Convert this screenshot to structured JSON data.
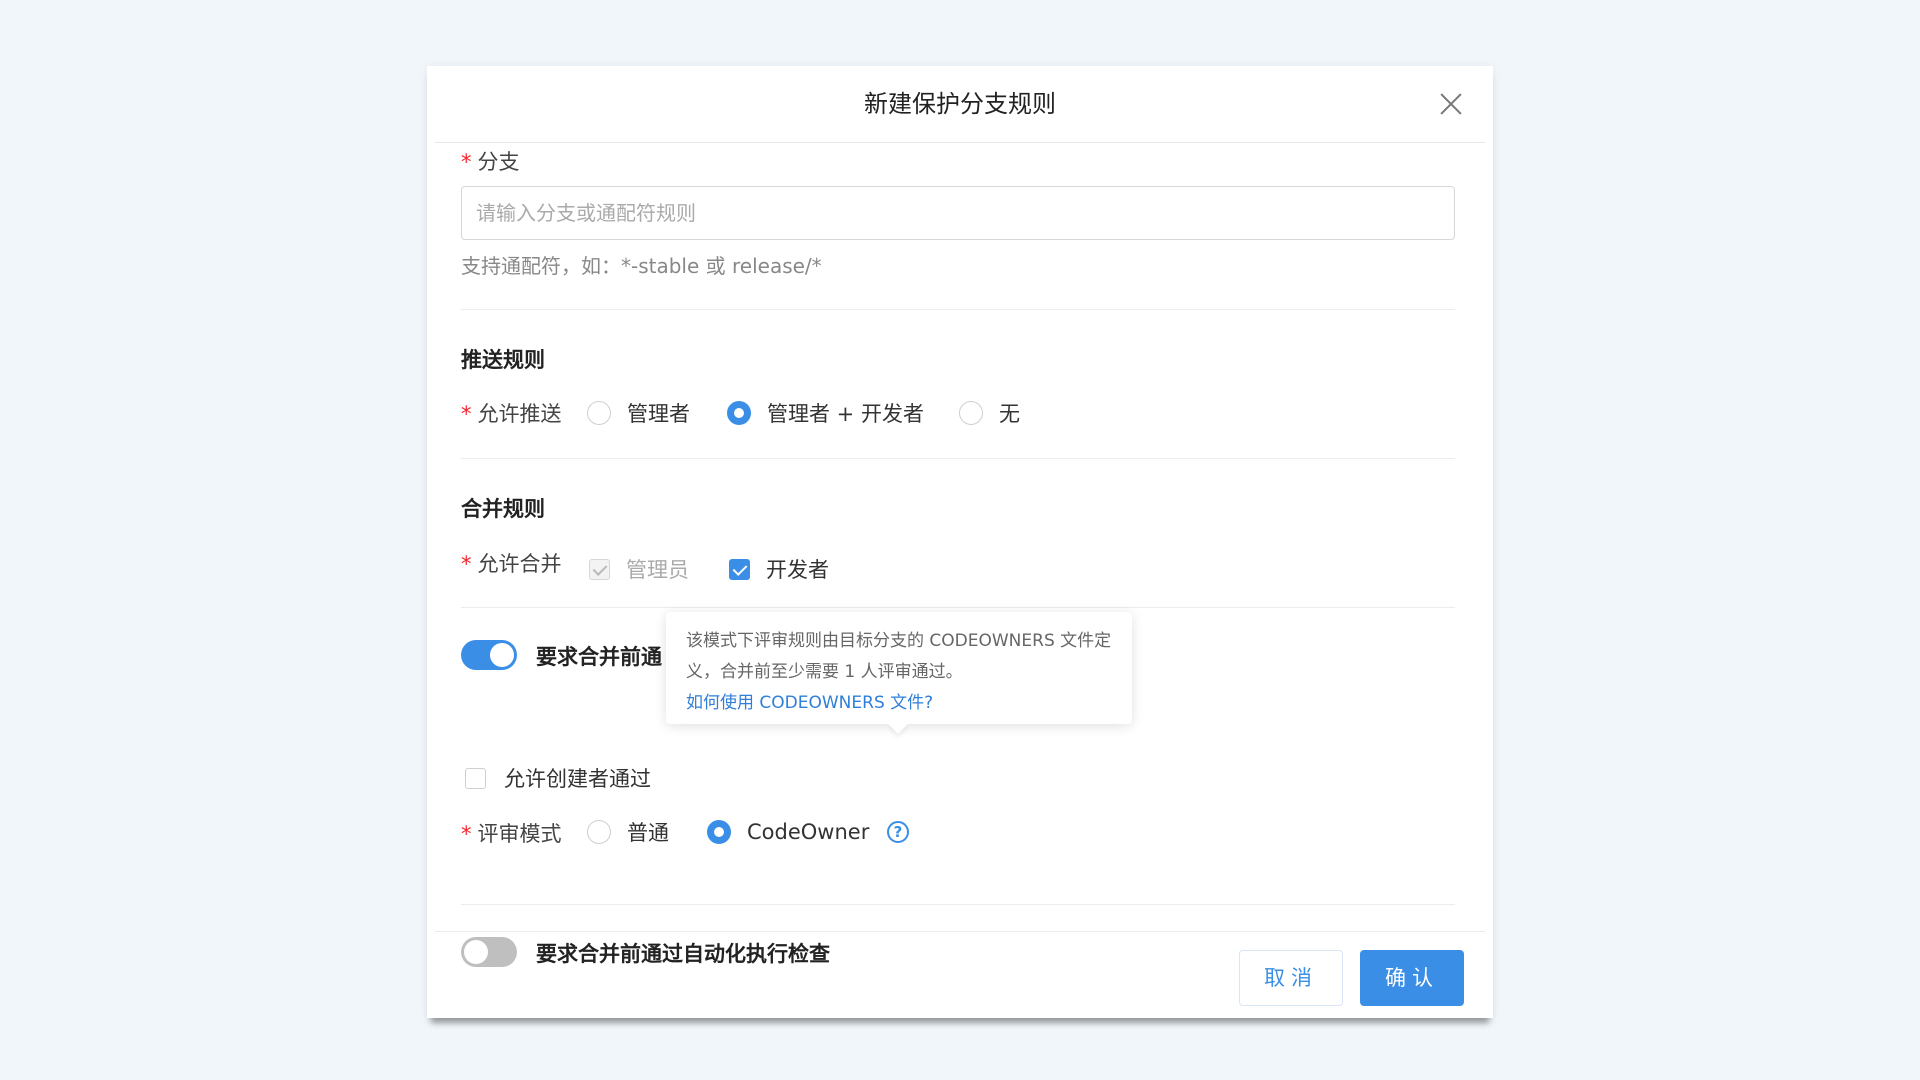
{
  "dialog": {
    "title": "新建保护分支规则",
    "close_icon": "close-icon"
  },
  "branch": {
    "required_mark": "*",
    "label": "分支",
    "placeholder": "请输入分支或通配符规则",
    "value": "",
    "hint": "支持通配符，如：*-stable 或 release/*"
  },
  "push_rules": {
    "section_title": "推送规则",
    "required_mark": "*",
    "label": "允许推送",
    "options": [
      {
        "label": "管理者",
        "checked": false
      },
      {
        "label": "管理者 + 开发者",
        "checked": true
      },
      {
        "label": "无",
        "checked": false
      }
    ]
  },
  "merge_rules": {
    "section_title": "合并规则",
    "required_mark": "*",
    "label": "允许合并",
    "options": [
      {
        "label": "管理员",
        "checked": true,
        "disabled": true
      },
      {
        "label": "开发者",
        "checked": true,
        "disabled": false
      }
    ]
  },
  "review": {
    "toggle_on": true,
    "toggle_label": "要求合并前通",
    "allow_creator_label": "允许创建者通过",
    "allow_creator_checked": false,
    "required_mark": "*",
    "mode_label": "评审模式",
    "mode_options": [
      {
        "label": "普通",
        "checked": false
      },
      {
        "label": "CodeOwner",
        "checked": true
      }
    ],
    "help_icon_text": "?"
  },
  "tooltip": {
    "text": "该模式下评审规则由目标分支的 CODEOWNERS 文件定义，合并前至少需要 1 人评审通过。",
    "link": "如何使用 CODEOWNERS 文件?"
  },
  "auto_check": {
    "toggle_on": false,
    "toggle_label": "要求合并前通过自动化执行检查"
  },
  "footer": {
    "cancel_label": "取消",
    "confirm_label": "确认"
  },
  "colors": {
    "accent": "#3a8ee6",
    "required": "#f5222d",
    "page_bg": "#f1f6fa"
  }
}
